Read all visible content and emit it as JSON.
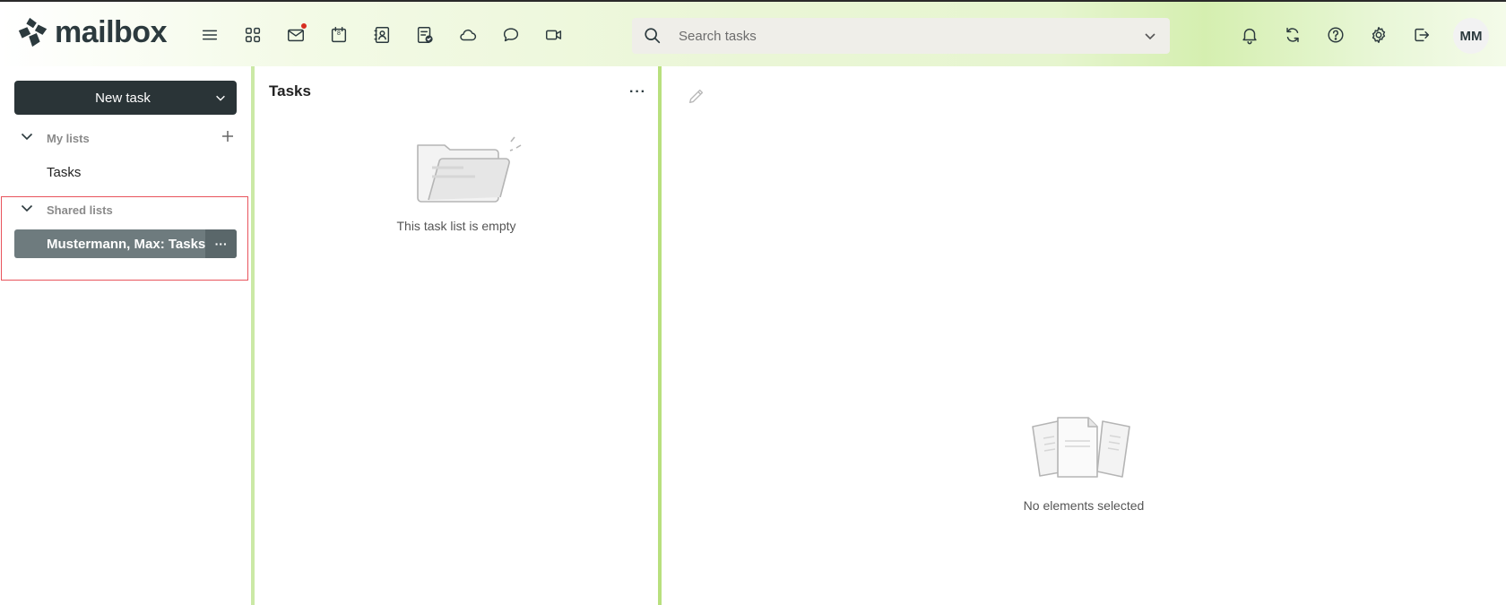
{
  "app": {
    "name": "mailbox"
  },
  "header": {
    "nav_icons": [
      "menu-icon",
      "apps-grid-icon",
      "mail-icon",
      "calendar-icon",
      "contacts-icon",
      "tasks-icon",
      "cloud-icon",
      "chat-icon",
      "video-icon"
    ],
    "calendar_day": "8",
    "mail_unread": true,
    "search": {
      "placeholder": "Search tasks"
    },
    "right_icons": [
      "bell-icon",
      "refresh-icon",
      "help-icon",
      "gear-icon",
      "logout-icon"
    ],
    "avatar_initials": "MM"
  },
  "sidebar": {
    "new_task_label": "New task",
    "my_lists": {
      "title": "My lists",
      "items": [
        "Tasks"
      ]
    },
    "shared_lists": {
      "title": "Shared lists",
      "items": [
        {
          "label": "Mustermann, Max: Tasks",
          "more": "···"
        }
      ]
    }
  },
  "list_pane": {
    "title": "Tasks",
    "more": "···",
    "empty_text": "This task list is empty"
  },
  "detail_pane": {
    "empty_text": "No elements selected"
  },
  "colors": {
    "accent_green": "#b8e07e",
    "dark_button": "#2a3437",
    "selected_item": "#6e7b7e",
    "highlight_border": "#e8545c",
    "notification_dot": "#d62d20"
  }
}
